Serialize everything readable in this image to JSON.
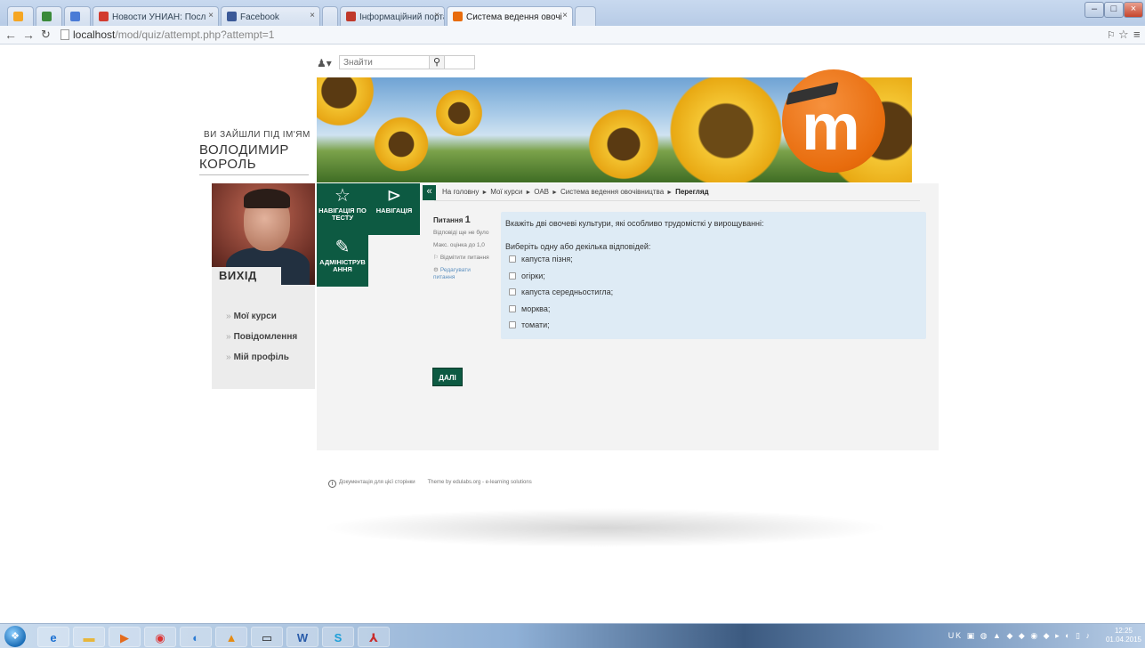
{
  "browser": {
    "tabs": [
      {
        "title": ""
      },
      {
        "title": ""
      },
      {
        "title": ""
      },
      {
        "title": "Новости УНИАН: Посл"
      },
      {
        "title": "Facebook"
      },
      {
        "title": ""
      },
      {
        "title": "Інформаційний портал"
      },
      {
        "title": "Система ведення овочі"
      }
    ],
    "url_host": "localhost",
    "url_path": "/mod/quiz/attempt.php?attempt=1"
  },
  "header": {
    "search_placeholder": "Знайти"
  },
  "user": {
    "logged_in_label": "ВИ ЗАЙШЛИ ПІД ІМ'ЯМ",
    "name_line1": "ВОЛОДИМИР",
    "name_line2": "КОРОЛЬ",
    "logout_label": "ВИХІД"
  },
  "side_menu": [
    {
      "label": "Мої курси"
    },
    {
      "label": "Повідомлення"
    },
    {
      "label": "Мій профіль"
    }
  ],
  "tiles": {
    "quiz_nav_line1": "НАВІГАЦІЯ ПО",
    "quiz_nav_line2": "ТЕСТУ",
    "navigation": "НАВІГАЦІЯ",
    "admin_line1": "АДМІНІСТРУВ",
    "admin_line2": "АННЯ"
  },
  "breadcrumb": [
    {
      "label": "На головну"
    },
    {
      "label": "Мої курси"
    },
    {
      "label": "ОАВ"
    },
    {
      "label": "Система ведення овочівництва"
    },
    {
      "label": "Перегляд"
    }
  ],
  "question_info": {
    "label": "Питання",
    "number": "1",
    "status": "Відповіді ще не було",
    "max_grade": "Макс. оцінка до 1,0",
    "flag": "Відмітити питання",
    "edit": "Редагувати питання"
  },
  "question": {
    "text": "Вкажіть дві овочеві культури, які особливо трудомісткі у вирощуванні:",
    "prompt": "Виберіть одну або декілька відповідей:",
    "answers": [
      {
        "label": "капуста пізня;",
        "checked": false
      },
      {
        "label": "огірки;",
        "checked": false
      },
      {
        "label": "капуста середньостигла;",
        "checked": false
      },
      {
        "label": "морква;",
        "checked": false
      },
      {
        "label": "томати;",
        "checked": false
      }
    ]
  },
  "next_button": "ДАЛІ",
  "footer": {
    "docs": "Документація для цієї сторінки",
    "theme": "Theme by edulabs.org - e-learning solutions"
  },
  "taskbar": {
    "lang": "UK",
    "time": "12:25",
    "date": "01.04.2015"
  },
  "colors": {
    "accent_green": "#0d5a42",
    "question_bg": "#deebf5",
    "moodle_orange": "#e86c0d"
  }
}
